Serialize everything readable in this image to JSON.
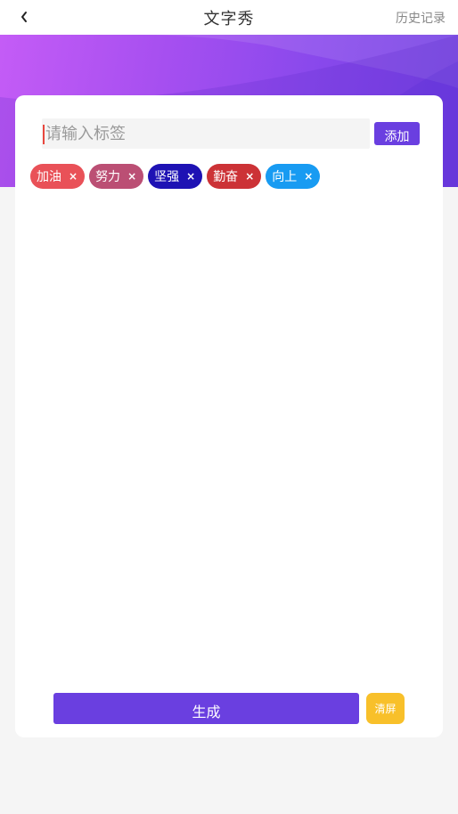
{
  "header": {
    "title": "文字秀",
    "history_label": "历史记录",
    "back_icon": "chevron-left-icon"
  },
  "input": {
    "placeholder": "请输入标签",
    "value": ""
  },
  "add_button_label": "添加",
  "tags": [
    {
      "label": "加油",
      "remove": "×",
      "color": "#e95158"
    },
    {
      "label": "努力",
      "remove": "×",
      "color": "#bb4f74"
    },
    {
      "label": "坚强",
      "remove": "×",
      "color": "#1e12b4"
    },
    {
      "label": "勤奋",
      "remove": "×",
      "color": "#cc3236"
    },
    {
      "label": "向上",
      "remove": "×",
      "color": "#189bf2"
    }
  ],
  "generate_button_label": "生成",
  "clear_button_label": "清屏",
  "colors": {
    "accent": "#6a3fe0",
    "clear_button": "#f8c02a",
    "banner_start": "#c45cf6",
    "banner_end": "#7140e2"
  }
}
